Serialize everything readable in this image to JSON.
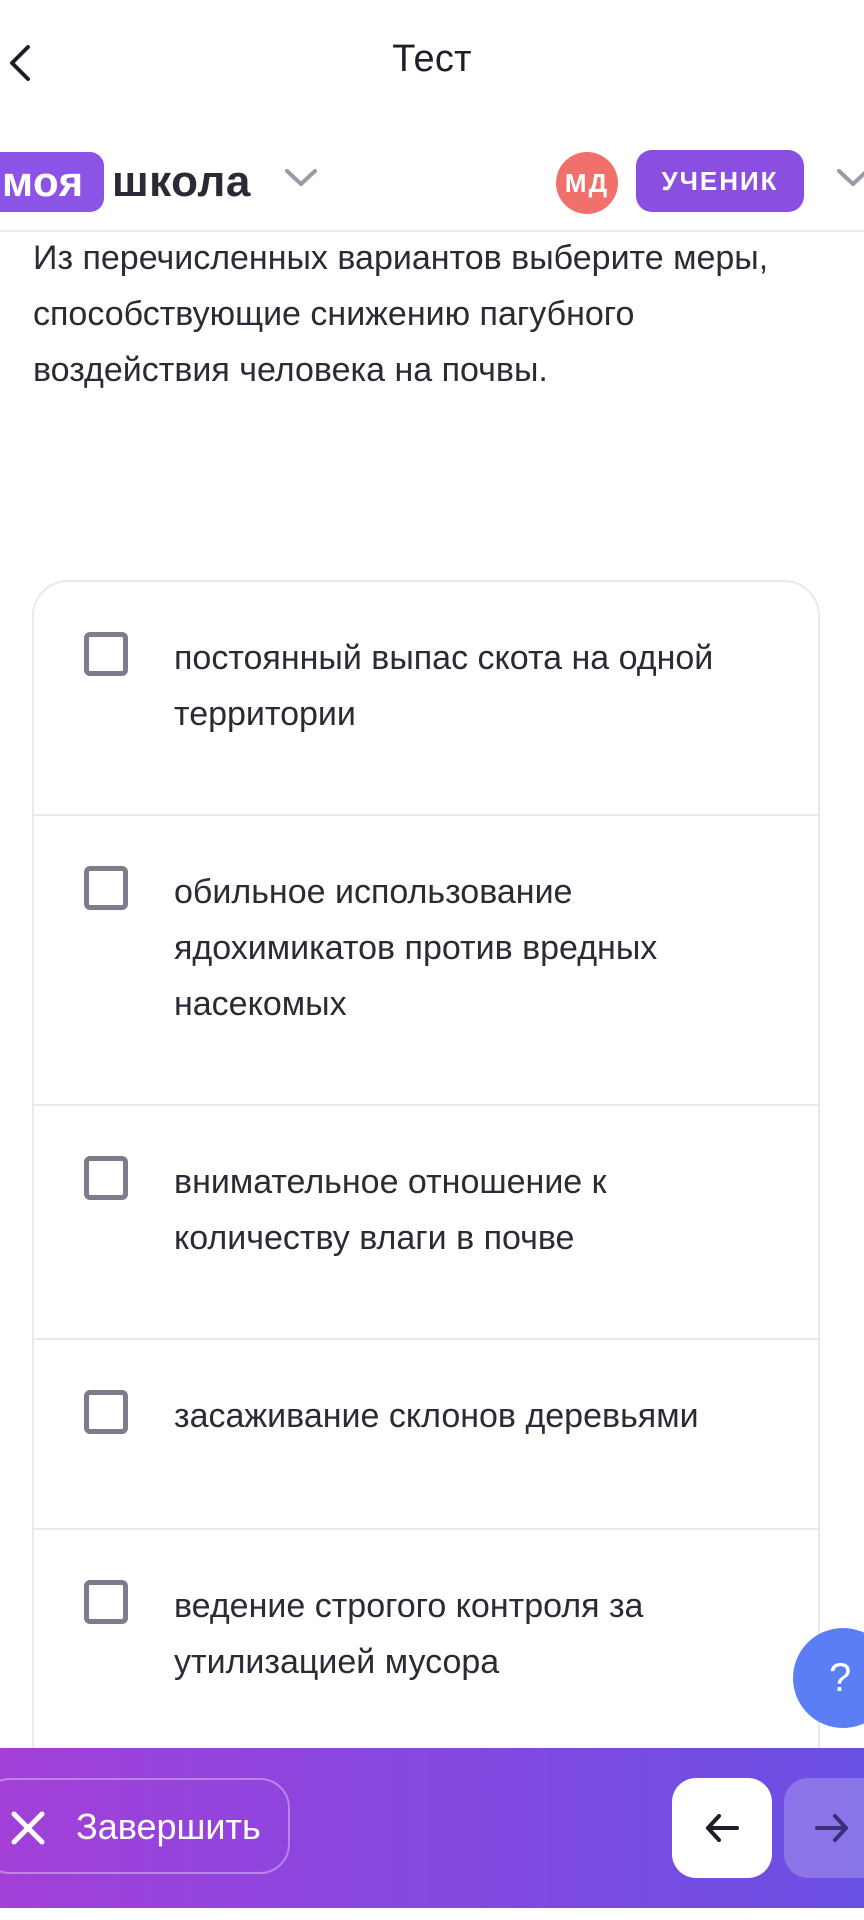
{
  "topbar": {
    "title": "Тест"
  },
  "header": {
    "logo_part1": "моя",
    "logo_part2": "школа",
    "avatar_initials": "МД",
    "role": "УЧЕНИК"
  },
  "question": {
    "text": "Из перечисленных вариантов выберите меры, способствующие снижению пагубного воздействия человека на почвы."
  },
  "options": [
    {
      "label": "постоянный выпас скота на одной территории",
      "checked": false
    },
    {
      "label": "обильное использование ядохимикатов против вредных насекомых",
      "checked": false
    },
    {
      "label": "внимательное отношение к количеству влаги в почве",
      "checked": false
    },
    {
      "label": "засаживание склонов деревьями",
      "checked": false
    },
    {
      "label": "ведение строгого контроля за утилизацией мусора",
      "checked": false
    }
  ],
  "help": {
    "label": "?"
  },
  "bottom": {
    "finish_label": "Завершить"
  },
  "colors": {
    "brand_purple": "#8a4fe0",
    "avatar_red": "#f0706c",
    "help_blue": "#5b7ef5"
  }
}
